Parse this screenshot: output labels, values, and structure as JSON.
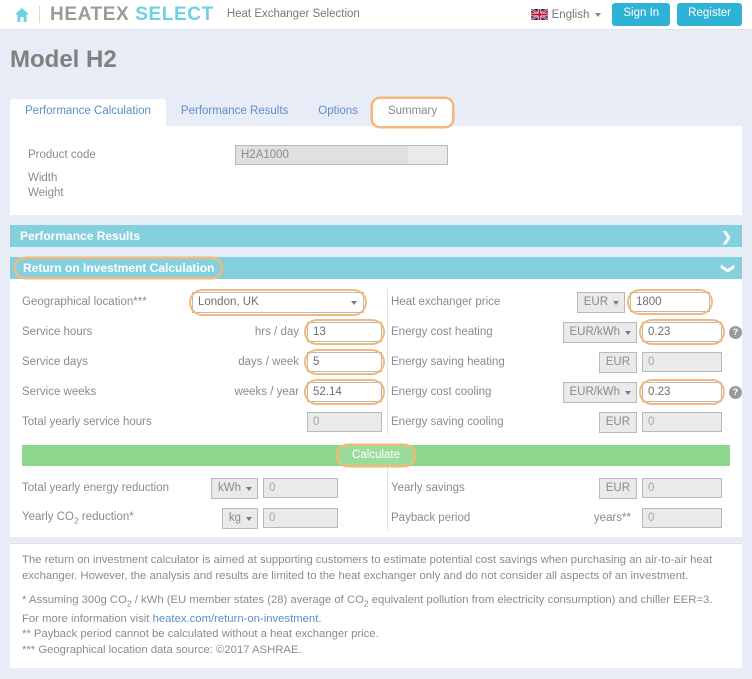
{
  "topbar": {
    "home_icon": "home-icon",
    "brand_primary": "HEATEX",
    "brand_secondary": "SELECT",
    "tagline": "Heat Exchanger Selection",
    "language": "English",
    "sign_in": "Sign In",
    "register": "Register",
    "accent_color": "#2eb3d4"
  },
  "page": {
    "title": "Model H2"
  },
  "tabs": [
    {
      "label": "Performance Calculation",
      "state": "active"
    },
    {
      "label": "Performance Results",
      "state": "inactive"
    },
    {
      "label": "Options",
      "state": "inactive"
    },
    {
      "label": "Summary",
      "state": "focused"
    }
  ],
  "summary_panel": {
    "product_code_label": "Product code",
    "product_code_value": "H2A1000",
    "width_label": "Width",
    "weight_label": "Weight"
  },
  "accordions": [
    {
      "title": "Performance Results",
      "chevron": "chevron-right-icon",
      "expanded": false,
      "focused": false
    },
    {
      "title": "Return on Investment Calculation",
      "chevron": "chevron-down-icon",
      "expanded": true,
      "focused": true
    }
  ],
  "roi": {
    "left": {
      "geo_label": "Geographical location***",
      "geo_value": "London, UK",
      "service_hours_label": "Service hours",
      "service_hours_unit": "hrs / day",
      "service_hours_value": "13",
      "service_days_label": "Service days",
      "service_days_unit": "days / week",
      "service_days_value": "5",
      "service_weeks_label": "Service weeks",
      "service_weeks_unit": "weeks / year",
      "service_weeks_value": "52.14",
      "total_hours_label": "Total yearly service hours",
      "total_hours_value": "0"
    },
    "right": {
      "price_label": "Heat exchanger price",
      "price_unit": "EUR",
      "price_value": "1800",
      "cost_heating_label": "Energy cost heating",
      "cost_heating_unit": "EUR/kWh",
      "cost_heating_value": "0.23",
      "saving_heating_label": "Energy saving heating",
      "saving_heating_unit": "EUR",
      "saving_heating_value": "0",
      "cost_cooling_label": "Energy cost cooling",
      "cost_cooling_unit": "EUR/kWh",
      "cost_cooling_value": "0.23",
      "saving_cooling_label": "Energy saving cooling",
      "saving_cooling_unit": "EUR",
      "saving_cooling_value": "0",
      "help_icon": "help-circle-icon"
    },
    "calculate_label": "Calculate",
    "results": {
      "energy_reduction_label": "Total yearly energy reduction",
      "energy_reduction_unit": "kWh",
      "energy_reduction_value": "0",
      "co2_reduction_label_pre": "Yearly CO",
      "co2_reduction_label_sub": "2",
      "co2_reduction_label_post": " reduction*",
      "co2_reduction_unit": "kg",
      "co2_reduction_value": "0",
      "yearly_savings_label": "Yearly savings",
      "yearly_savings_unit": "EUR",
      "yearly_savings_value": "0",
      "payback_label": "Payback period",
      "payback_unit": "years**",
      "payback_value": "0"
    }
  },
  "notes": {
    "intro": "The return on investment calculator is aimed at supporting customers to estimate potential cost savings when purchasing an air-to-air heat exchanger. However, the analysis and results are limited to the heat exchanger only and do not consider all aspects of an investment.",
    "note1_a": "* Assuming 300g CO",
    "note1_sub1": "2",
    "note1_b": " / kWh (EU member states (28) average of CO",
    "note1_sub2": "2",
    "note1_c": " equivalent pollution from electricity consumption) and chiller EER=3. For more information visit ",
    "note1_link": "heatex.com/return-on-investment",
    "note1_end": ".",
    "note2": "** Payback period cannot be calculated without a heat exchanger price.",
    "note3": "*** Geographical location data source: ©2017 ASHRAE."
  }
}
